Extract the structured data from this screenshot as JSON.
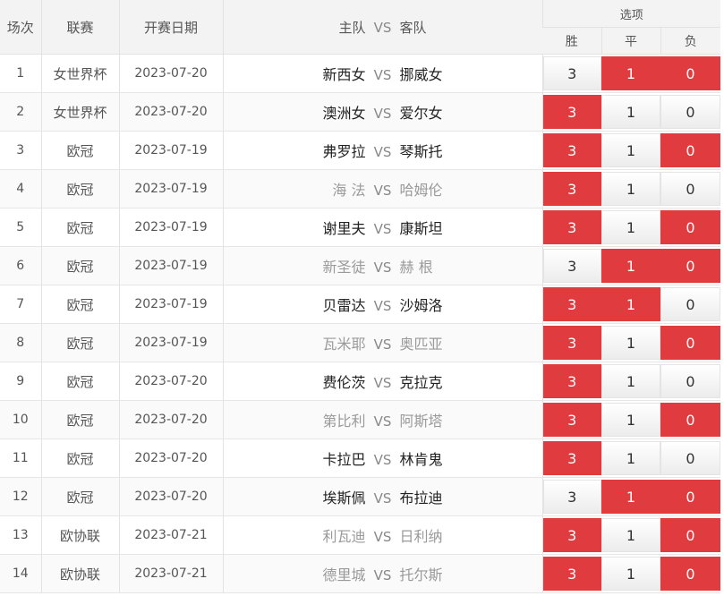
{
  "headers": {
    "index": "场次",
    "league": "联赛",
    "date": "开赛日期",
    "match_home": "主队",
    "match_vs": "VS",
    "match_away": "客队",
    "options": "选项",
    "win": "胜",
    "draw": "平",
    "lose": "负"
  },
  "colors": {
    "selected": "#e03b3f",
    "header_bg": "#f3f3f3",
    "dim_team": "#9a9a9a"
  },
  "rows": [
    {
      "index": "1",
      "league": "女世界杯",
      "date": "2023-07-20",
      "home": "新西女",
      "away": "挪威女",
      "win": "3",
      "draw": "1",
      "lose": "0",
      "home_dim": false,
      "away_dim": false
    },
    {
      "index": "2",
      "league": "女世界杯",
      "date": "2023-07-20",
      "home": "澳洲女",
      "away": "爱尔女",
      "win": "3",
      "draw": "1",
      "lose": "0",
      "home_dim": false,
      "away_dim": false
    },
    {
      "index": "3",
      "league": "欧冠",
      "date": "2023-07-19",
      "home": "弗罗拉",
      "away": "琴斯托",
      "win": "3",
      "draw": "1",
      "lose": "0",
      "home_dim": false,
      "away_dim": false
    },
    {
      "index": "4",
      "league": "欧冠",
      "date": "2023-07-19",
      "home": "海 法",
      "away": "哈姆伦",
      "win": "3",
      "draw": "1",
      "lose": "0",
      "home_dim": true,
      "away_dim": true
    },
    {
      "index": "5",
      "league": "欧冠",
      "date": "2023-07-19",
      "home": "谢里夫",
      "away": "康斯坦",
      "win": "3",
      "draw": "1",
      "lose": "0",
      "home_dim": false,
      "away_dim": false
    },
    {
      "index": "6",
      "league": "欧冠",
      "date": "2023-07-19",
      "home": "新圣徒",
      "away": "赫 根",
      "win": "3",
      "draw": "1",
      "lose": "0",
      "home_dim": true,
      "away_dim": true
    },
    {
      "index": "7",
      "league": "欧冠",
      "date": "2023-07-19",
      "home": "贝雷达",
      "away": "沙姆洛",
      "win": "3",
      "draw": "1",
      "lose": "0",
      "home_dim": false,
      "away_dim": false
    },
    {
      "index": "8",
      "league": "欧冠",
      "date": "2023-07-19",
      "home": "瓦米耶",
      "away": "奥匹亚",
      "win": "3",
      "draw": "1",
      "lose": "0",
      "home_dim": true,
      "away_dim": true
    },
    {
      "index": "9",
      "league": "欧冠",
      "date": "2023-07-20",
      "home": "费伦茨",
      "away": "克拉克",
      "win": "3",
      "draw": "1",
      "lose": "0",
      "home_dim": false,
      "away_dim": false
    },
    {
      "index": "10",
      "league": "欧冠",
      "date": "2023-07-20",
      "home": "第比利",
      "away": "阿斯塔",
      "win": "3",
      "draw": "1",
      "lose": "0",
      "home_dim": true,
      "away_dim": true
    },
    {
      "index": "11",
      "league": "欧冠",
      "date": "2023-07-20",
      "home": "卡拉巴",
      "away": "林肯鬼",
      "win": "3",
      "draw": "1",
      "lose": "0",
      "home_dim": false,
      "away_dim": false
    },
    {
      "index": "12",
      "league": "欧冠",
      "date": "2023-07-20",
      "home": "埃斯佩",
      "away": "布拉迪",
      "win": "3",
      "draw": "1",
      "lose": "0",
      "home_dim": false,
      "away_dim": false
    },
    {
      "index": "13",
      "league": "欧协联",
      "date": "2023-07-21",
      "home": "利瓦迪",
      "away": "日利纳",
      "win": "3",
      "draw": "1",
      "lose": "0",
      "home_dim": true,
      "away_dim": true
    },
    {
      "index": "14",
      "league": "欧协联",
      "date": "2023-07-21",
      "home": "德里城",
      "away": "托尔斯",
      "win": "3",
      "draw": "1",
      "lose": "0",
      "home_dim": true,
      "away_dim": true
    }
  ],
  "selections": [
    {
      "win": false,
      "draw": true,
      "lose": true
    },
    {
      "win": true,
      "draw": false,
      "lose": false
    },
    {
      "win": true,
      "draw": false,
      "lose": true
    },
    {
      "win": true,
      "draw": false,
      "lose": false
    },
    {
      "win": true,
      "draw": false,
      "lose": true
    },
    {
      "win": false,
      "draw": true,
      "lose": true
    },
    {
      "win": true,
      "draw": true,
      "lose": false
    },
    {
      "win": true,
      "draw": false,
      "lose": true
    },
    {
      "win": true,
      "draw": false,
      "lose": false
    },
    {
      "win": true,
      "draw": false,
      "lose": true
    },
    {
      "win": true,
      "draw": false,
      "lose": false
    },
    {
      "win": false,
      "draw": true,
      "lose": true
    },
    {
      "win": true,
      "draw": false,
      "lose": true
    },
    {
      "win": true,
      "draw": false,
      "lose": true
    }
  ]
}
